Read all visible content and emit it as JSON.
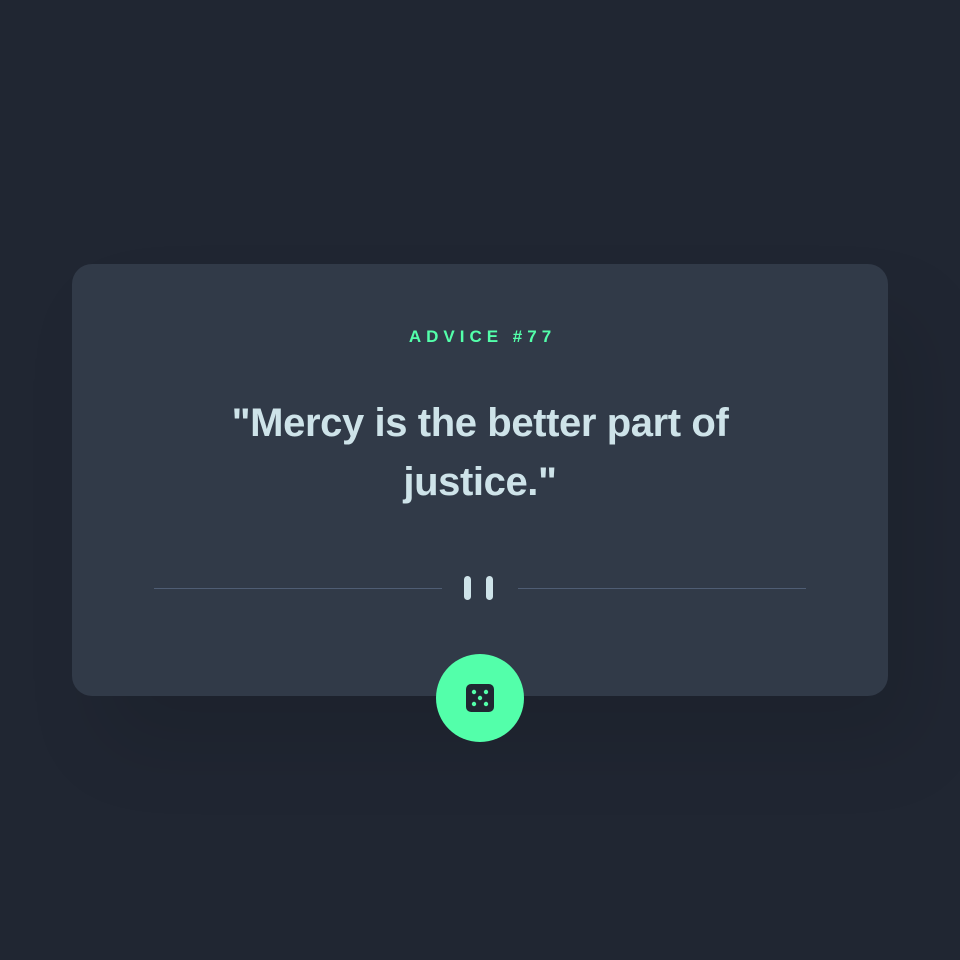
{
  "advice": {
    "label": "ADVICE #77",
    "quote": "\"Mercy is the better part of justice.\""
  },
  "divider": {
    "icon": "pause-icon"
  },
  "dice_button": {
    "icon": "dice-icon"
  },
  "colors": {
    "background": "#202632",
    "card": "#313A48",
    "accent": "#53FFAA",
    "text": "#CEE3E9",
    "divider": "#4F5D74"
  }
}
